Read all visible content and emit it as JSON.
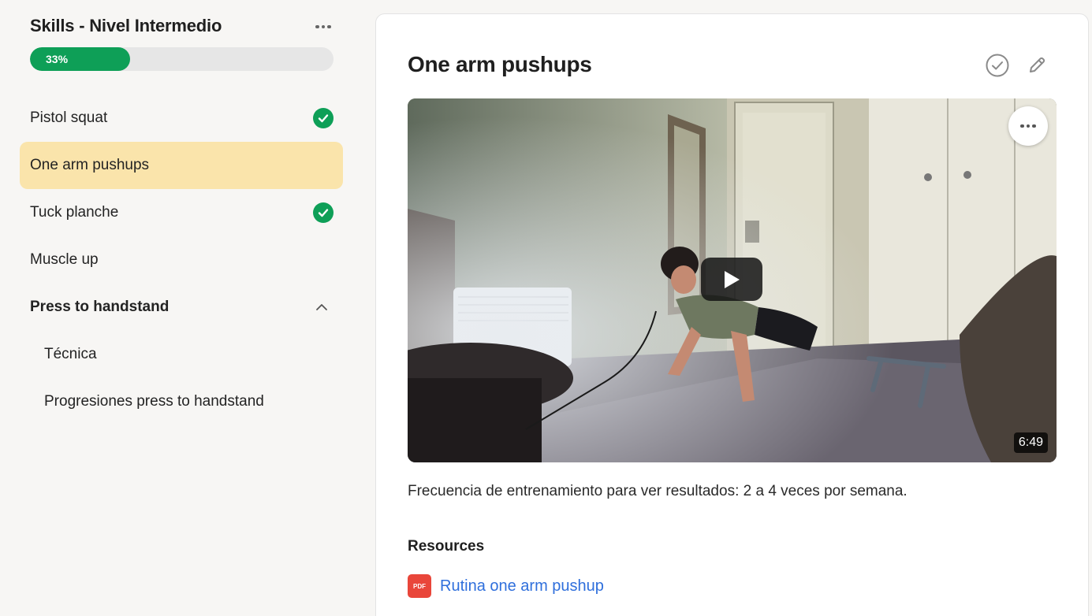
{
  "sidebar": {
    "course_title": "Skills - Nivel Intermedio",
    "progress": {
      "label": "33%",
      "percent": 33
    },
    "lessons": [
      {
        "label": "Pistol squat",
        "completed": true
      },
      {
        "label": "One arm pushups",
        "active": true
      },
      {
        "label": "Tuck planche",
        "completed": true
      },
      {
        "label": "Muscle up"
      },
      {
        "label": "Press to handstand",
        "expanded": true
      },
      {
        "label": "Técnica"
      },
      {
        "label": "Progresiones press to handstand"
      }
    ]
  },
  "main": {
    "title": "One arm pushups",
    "video": {
      "duration": "6:49"
    },
    "description": "Frecuencia de entrenamiento para ver resultados: 2 a 4 veces por semana.",
    "resources_heading": "Resources",
    "resources": [
      {
        "badge": "PDF",
        "label": "Rutina one arm pushup"
      }
    ]
  },
  "colors": {
    "accent_green": "#0e9f57",
    "active_item": "#fae4ab",
    "link_blue": "#2f6fdc",
    "pdf_red": "#e9463a"
  },
  "icons": [
    "more-dots-icon",
    "check-circle-icon",
    "chevron-up-icon",
    "complete-icon",
    "pencil-icon",
    "play-icon",
    "pdf-icon"
  ]
}
